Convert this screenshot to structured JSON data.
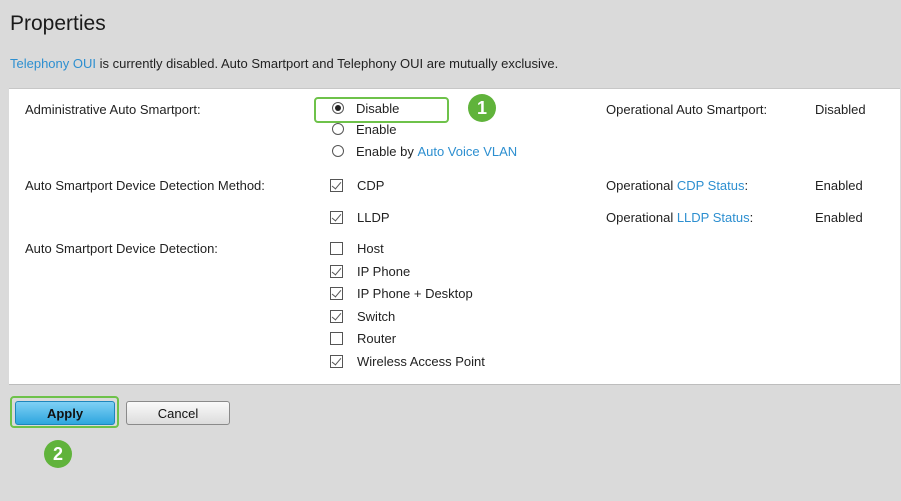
{
  "page": {
    "title": "Properties",
    "notice_link": "Telephony OUI",
    "notice_text": " is currently disabled. Auto Smartport and Telephony OUI are mutually exclusive."
  },
  "admin_smartport": {
    "label": "Administrative Auto Smartport:",
    "options": [
      "Disable",
      "Enable",
      "Enable by "
    ],
    "auto_voice_vlan_link": "Auto Voice VLAN",
    "selected": "Disable",
    "operational_label": "Operational Auto Smartport:",
    "operational_value": "Disabled"
  },
  "detection_method": {
    "label": "Auto Smartport Device Detection Method:",
    "cdp": {
      "label": "CDP",
      "checked": true
    },
    "lldp": {
      "label": "LLDP",
      "checked": true
    },
    "cdp_status_prefix": "Operational ",
    "cdp_status_link": "CDP Status",
    "cdp_status_suffix": ":",
    "cdp_status_value": "Enabled",
    "lldp_status_prefix": "Operational ",
    "lldp_status_link": "LLDP Status",
    "lldp_status_suffix": ":",
    "lldp_status_value": "Enabled"
  },
  "device_detection": {
    "label": "Auto Smartport Device Detection:",
    "items": [
      {
        "label": "Host",
        "checked": false
      },
      {
        "label": "IP Phone",
        "checked": true
      },
      {
        "label": "IP Phone + Desktop",
        "checked": true
      },
      {
        "label": "Switch",
        "checked": true
      },
      {
        "label": "Router",
        "checked": false
      },
      {
        "label": "Wireless Access Point",
        "checked": true
      }
    ]
  },
  "buttons": {
    "apply": "Apply",
    "cancel": "Cancel"
  },
  "callouts": {
    "one": "1",
    "two": "2"
  },
  "colors": {
    "accent_green": "#60b33b",
    "link_blue": "#2d8fd0",
    "apply_blue": "#2ea6df"
  }
}
